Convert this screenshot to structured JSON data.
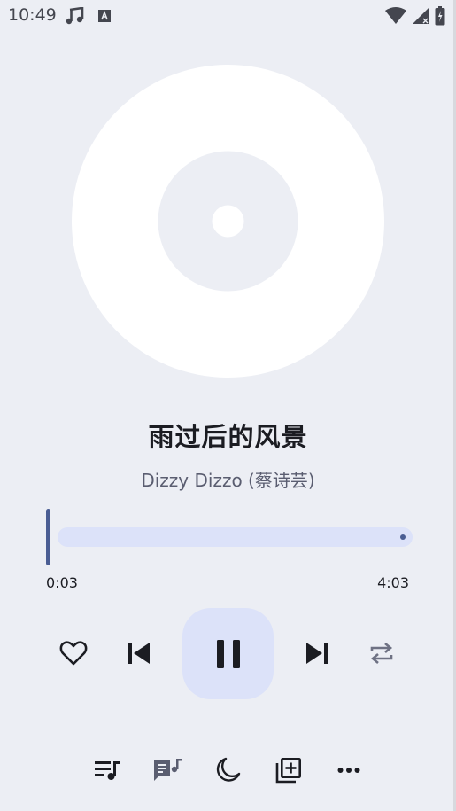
{
  "status_bar": {
    "time": "10:49",
    "left_icons": [
      "music-note-icon",
      "font-a-icon"
    ],
    "right_icons": [
      "wifi-icon",
      "signal-icon",
      "battery-icon"
    ]
  },
  "album": {
    "icon": "vinyl-disc-icon"
  },
  "song": {
    "title": "雨过后的风景",
    "artist": "Dizzy Dizzo (蔡诗芸)"
  },
  "progress": {
    "elapsed": "0:03",
    "total": "4:03",
    "fraction": 0.012
  },
  "controls": {
    "like_icon": "heart-outline-icon",
    "prev_icon": "skip-previous-icon",
    "play_state_icon": "pause-icon",
    "next_icon": "skip-next-icon",
    "repeat_icon": "repeat-icon"
  },
  "bottom_actions": [
    "queue-music-icon",
    "lyrics-icon",
    "sleep-timer-icon",
    "add-to-playlist-icon",
    "more-icon"
  ],
  "colors": {
    "background": "#eceef4",
    "accent": "#4a5d93",
    "accent_container": "#dce2f9",
    "on_surface": "#1b1c22",
    "secondary_text": "#5a5d70"
  }
}
